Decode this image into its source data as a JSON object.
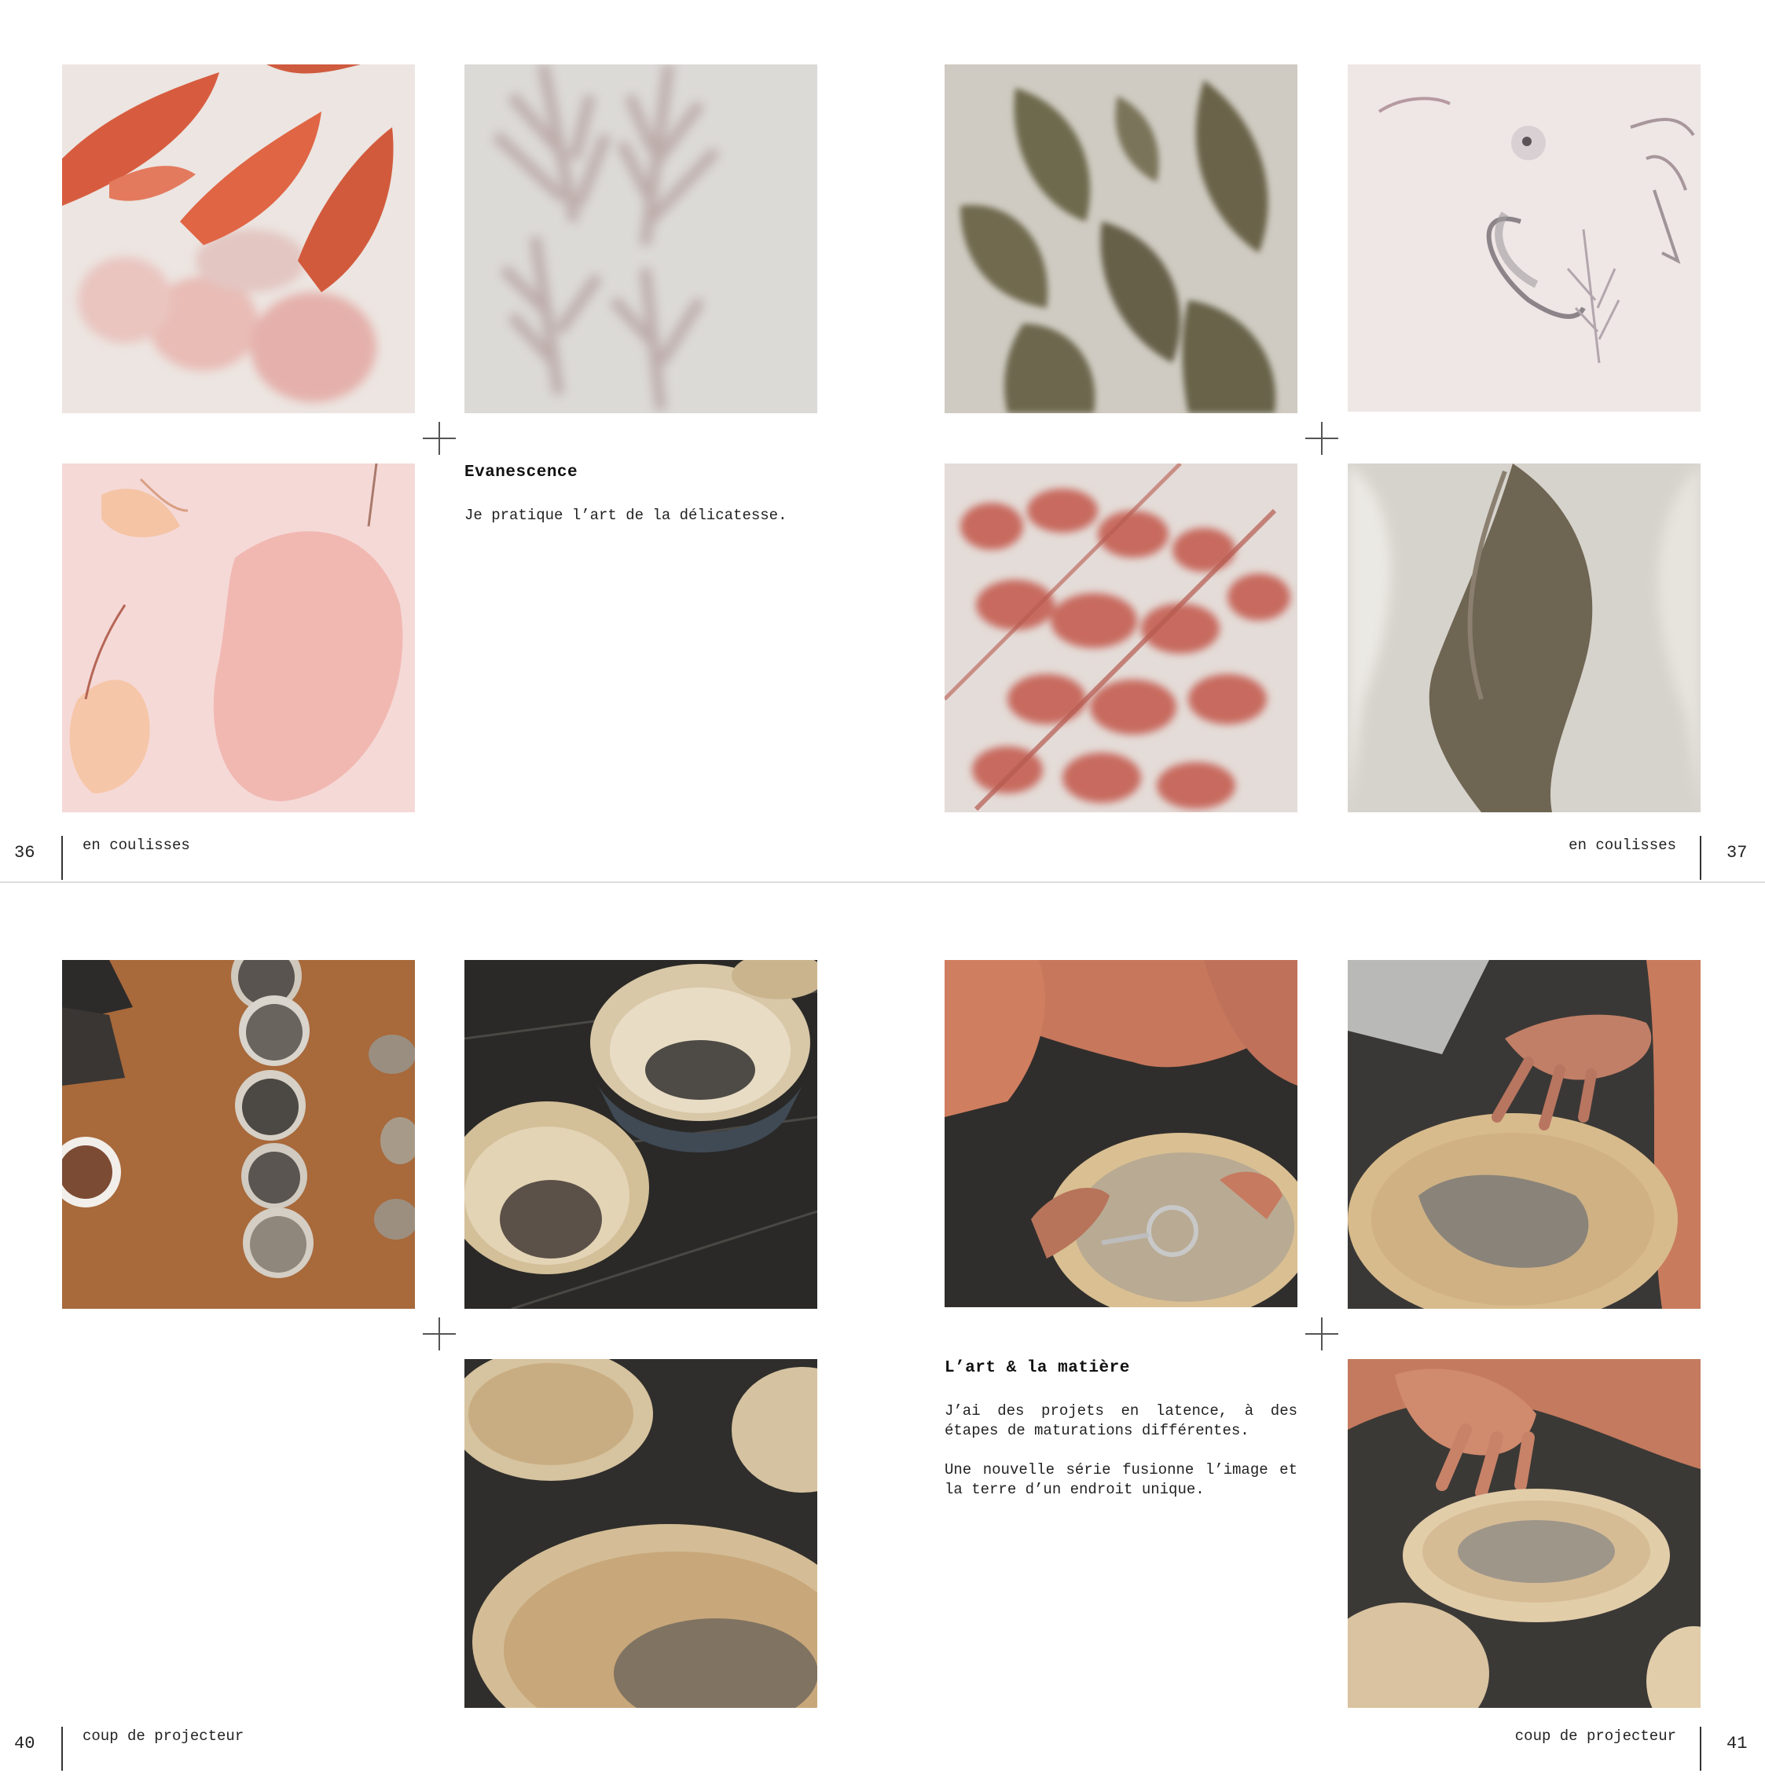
{
  "spread_top": {
    "title": "Evanescence",
    "body": "Je pratique l’art de la délicatesse.",
    "page_left": "36",
    "page_right": "37",
    "section_left": "en coulisses",
    "section_right": "en coulisses"
  },
  "spread_bottom": {
    "title": "L’art & la matière",
    "paragraph1": "J’ai des projets en latence, à des étapes de maturations différentes.",
    "paragraph2": "Une nouvelle série fusionne l’image et la terre d’un endroit unique.",
    "page_left": "40",
    "page_right": "41",
    "section_left": "coup de projecteur",
    "section_right": "coup de projecteur"
  }
}
